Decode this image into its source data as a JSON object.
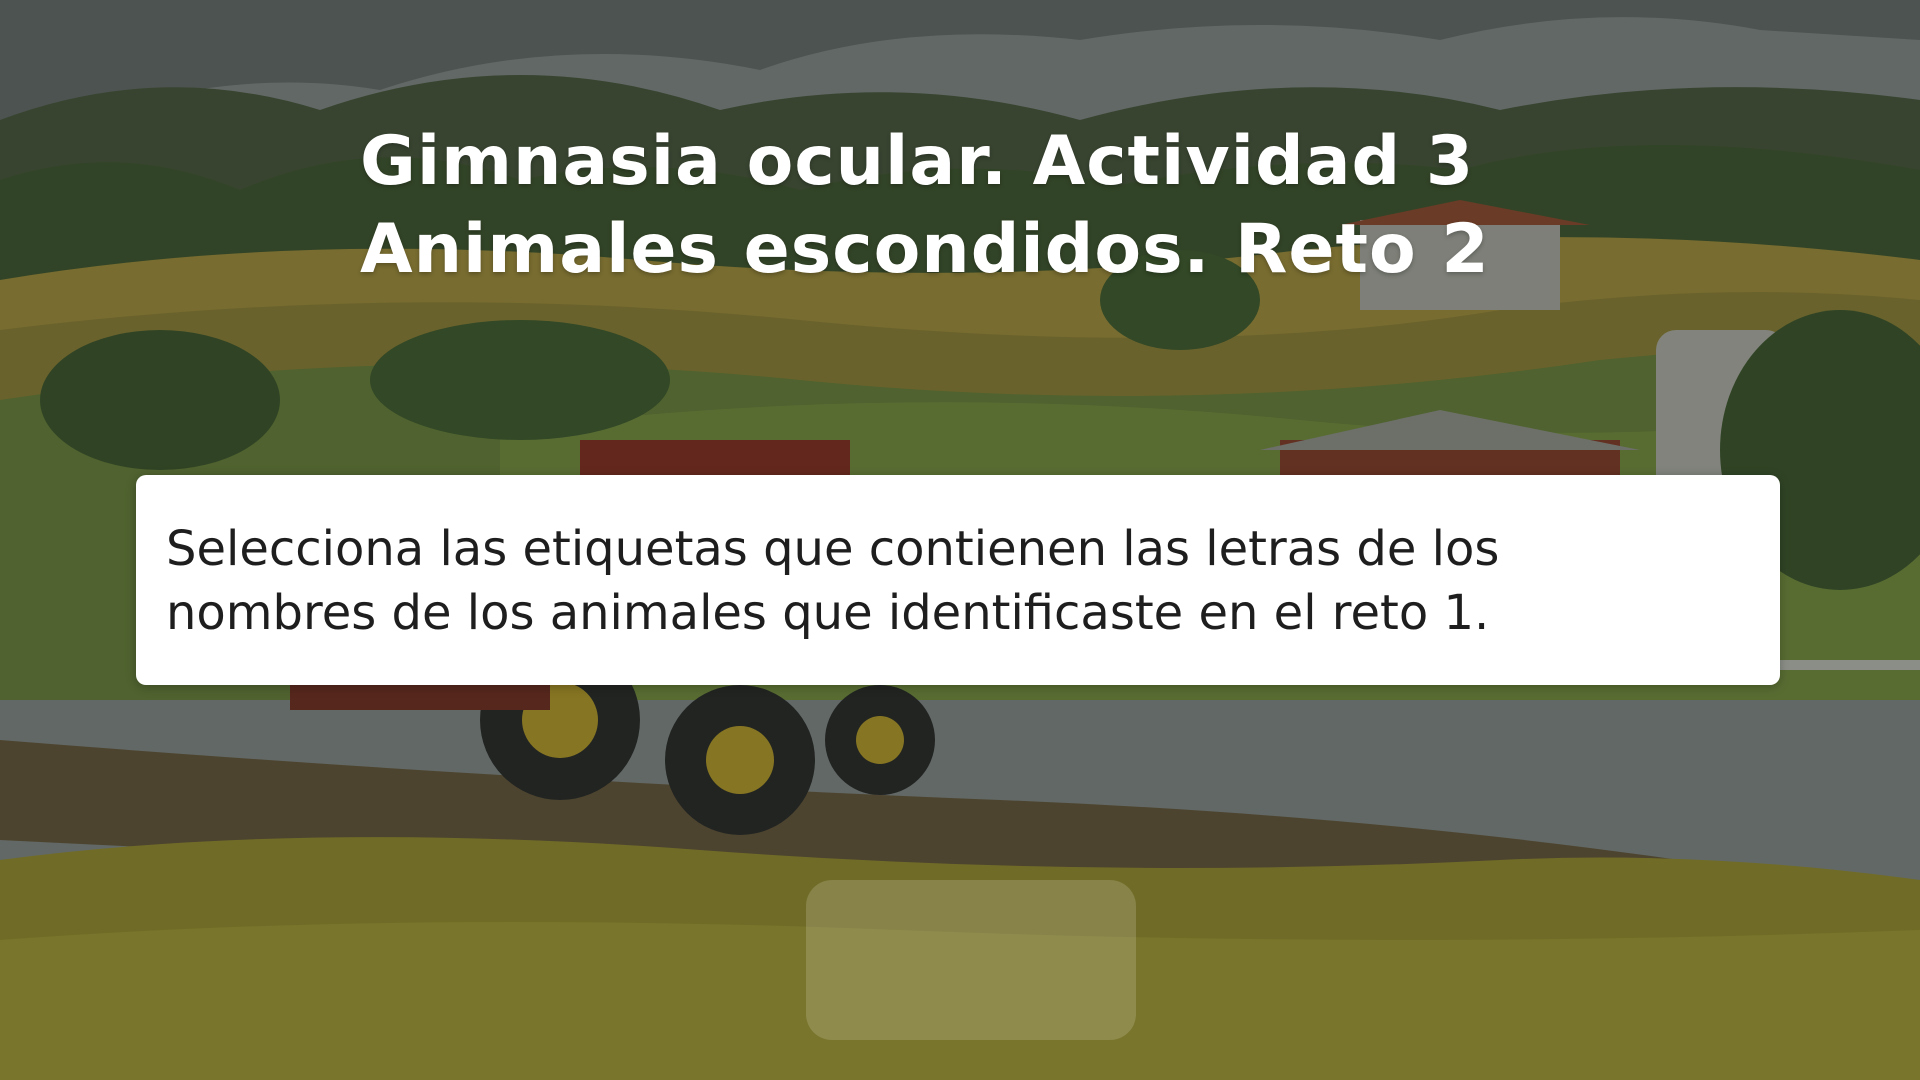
{
  "background": {
    "scene": "farm-landscape-illustration",
    "overlay_color": "#1e221e"
  },
  "header": {
    "title_line1": "Gimnasia ocular. Actividad 3",
    "title_line2": "Animales escondidos. Reto 2"
  },
  "instruction": {
    "text_line1": "Selecciona las etiquetas que contienen las letras de los",
    "text_line2": "nombres de los animales que identificaste en el reto 1."
  },
  "footer": {
    "button_label": ""
  },
  "colors": {
    "title": "#ffffff",
    "card_bg": "#ffffff",
    "card_text": "#1e1e1e"
  }
}
